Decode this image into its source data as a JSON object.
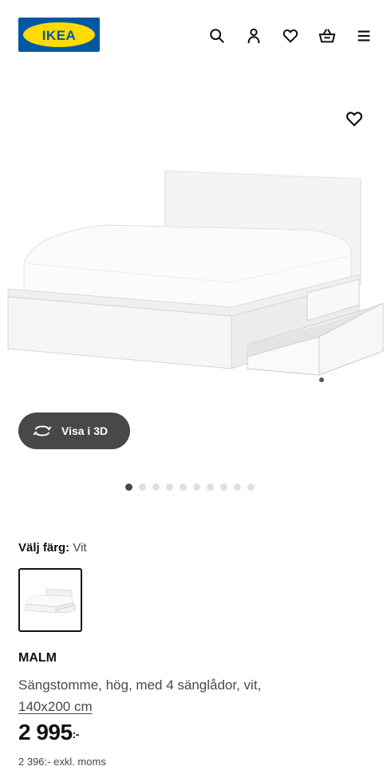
{
  "header": {
    "logo_text": "IKEA",
    "icons": [
      "search-icon",
      "user-icon",
      "heart-icon",
      "basket-icon",
      "menu-icon"
    ]
  },
  "product_image": {
    "favorite_icon": "heart-icon"
  },
  "view_3d": {
    "label": "Visa i 3D",
    "icon": "rotate-icon"
  },
  "carousel": {
    "total": 10,
    "active_index": 0
  },
  "color": {
    "label": "Välj färg:",
    "value": "Vit"
  },
  "product": {
    "name": "MALM",
    "description": "Sängstomme, hög, med 4 sänglådor, vit,",
    "size": "140x200 cm",
    "price_main": "2 995",
    "price_suffix": ":-",
    "price_ex_vat": "2 396:- exkl. moms"
  },
  "colors": {
    "brand_blue": "#0058a3",
    "brand_yellow": "#ffdb00",
    "button_dark": "#484848"
  }
}
